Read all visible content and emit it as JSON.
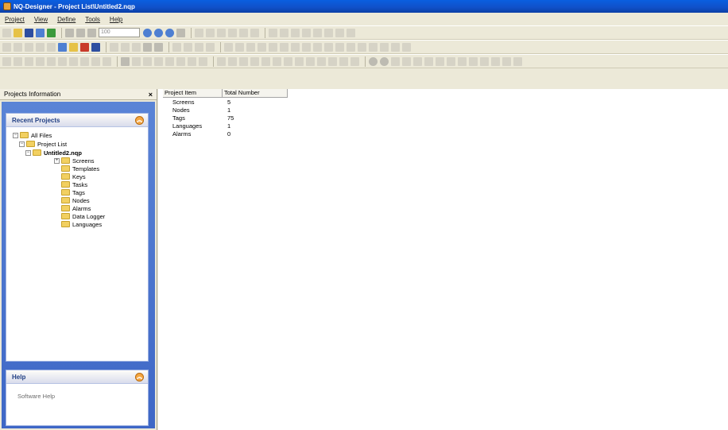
{
  "window": {
    "title": "NQ-Designer - Project List\\Untitled2.nqp"
  },
  "menu": [
    "Project",
    "View",
    "Define",
    "Tools",
    "Help"
  ],
  "toolbar": {
    "zoom_value": "100"
  },
  "panel": {
    "title": "Projects Information",
    "close_label": "×"
  },
  "recent_projects": {
    "header": "Recent Projects",
    "tree": [
      {
        "label": "All Files",
        "level": 0,
        "expander": "−",
        "bold": false
      },
      {
        "label": "Project List",
        "level": 1,
        "expander": "−",
        "bold": false
      },
      {
        "label": "Untitled2.nqp",
        "level": 2,
        "expander": "−",
        "bold": true
      },
      {
        "label": "Screens",
        "level": 3,
        "expander": "+",
        "bold": false
      },
      {
        "label": "Templates",
        "level": 3,
        "expander": "",
        "bold": false
      },
      {
        "label": "Keys",
        "level": 3,
        "expander": "",
        "bold": false
      },
      {
        "label": "Tasks",
        "level": 3,
        "expander": "",
        "bold": false
      },
      {
        "label": "Tags",
        "level": 3,
        "expander": "",
        "bold": false
      },
      {
        "label": "Nodes",
        "level": 3,
        "expander": "",
        "bold": false
      },
      {
        "label": "Alarms",
        "level": 3,
        "expander": "",
        "bold": false
      },
      {
        "label": "Data Logger",
        "level": 3,
        "expander": "",
        "bold": false
      },
      {
        "label": "Languages",
        "level": 3,
        "expander": "",
        "bold": false
      }
    ]
  },
  "help": {
    "header": "Help",
    "link": "Software Help"
  },
  "table": {
    "columns": [
      "Project Item",
      "Total Number"
    ],
    "rows": [
      {
        "item": "Screens",
        "total": "5"
      },
      {
        "item": "Nodes",
        "total": "1"
      },
      {
        "item": "Tags",
        "total": "75"
      },
      {
        "item": "Languages",
        "total": "1"
      },
      {
        "item": "Alarms",
        "total": "0"
      }
    ]
  },
  "colors": {
    "titlebar": "#0b50d0",
    "panel_blue": "#4a74cf",
    "accent_orange": "#f5a640"
  }
}
